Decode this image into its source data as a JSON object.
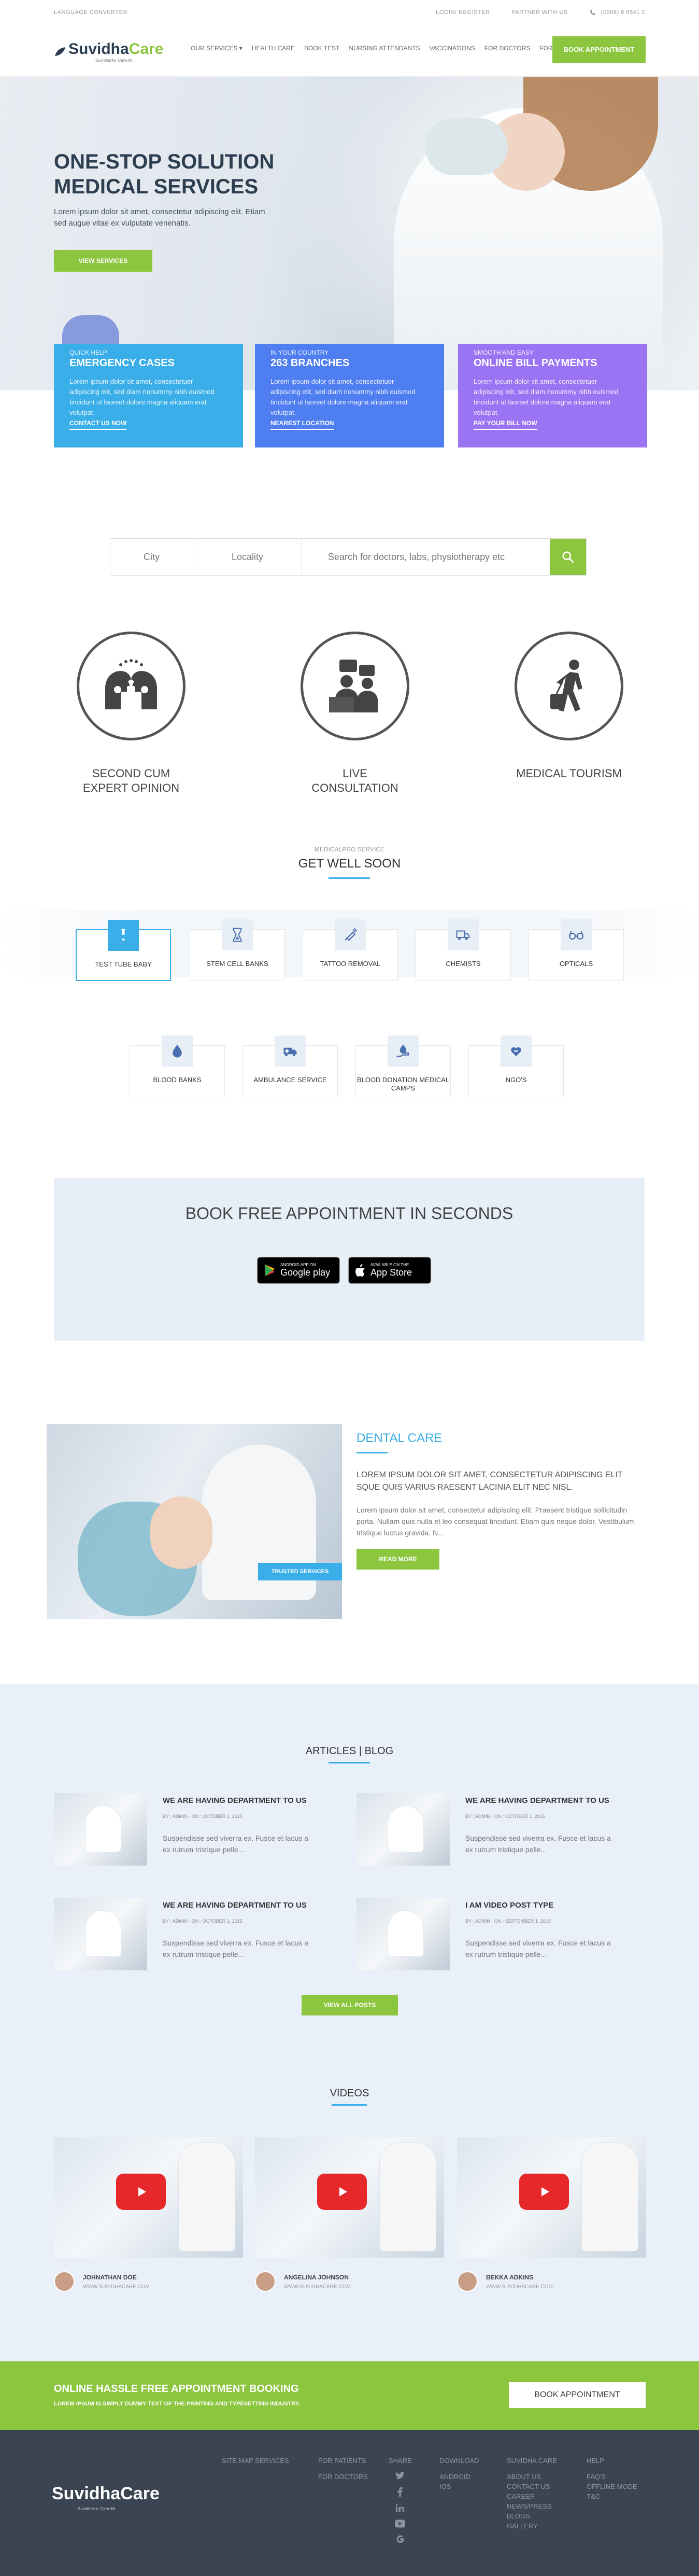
{
  "topbar": {
    "language": "LANGUAGE CONVERTER",
    "login": "LOGIN/ REGISTER",
    "partner": "PARTNER WITH US",
    "phone": "(0908) 8 6541 2"
  },
  "brand": {
    "name_a": "Suvidha",
    "name_b": "Care",
    "tagline": "SuvidhaHe. Care.Mr."
  },
  "nav": {
    "items": [
      "OUR SERVICES ▾",
      "HEALTH CARE",
      "BOOK TEST",
      "NURSING ATTENDANTS",
      "VACCINATIONS",
      "FOR DOCTORS",
      "FOR PATIENT"
    ],
    "book": "BOOK APPOINTMENT"
  },
  "hero": {
    "title": "ONE-STOP SOLUTION MEDICAL SERVICES",
    "text": "Lorem ipsum dolor sit amet, consectetur adipiscing elit. Etiam sed augue vitae ex vulputate venenatis.",
    "button": "VIEW SERVICES"
  },
  "cards": [
    {
      "kicker": "QUICK HELP",
      "title": "EMERGENCY CASES",
      "text": "Lorem ipsum dolor sit amet, consectetuer adipiscing elit, sed diam nonummy nibh euismod tincidunt ut laoreet dolore magna aliquam erat volutpat.",
      "link": "CONTACT US NOW",
      "color": "#3aaee8"
    },
    {
      "kicker": "IN YOUR COUNTRY",
      "title": "263 BRANCHES",
      "text": "Lorem ipsum dolor sit amet, consectetuer adipiscing elit, sed diam nonummy nibh euismod tincidunt ut laoreet dolore magna aliquam erat volutpat.",
      "link": "NEAREST LOCATION",
      "color": "#4f7ef0"
    },
    {
      "kicker": "SMOOTH AND EASY",
      "title": "ONLINE BILL PAYMENTS",
      "text": "Lorem ipsum dolor sit amet, consectetuer adipiscing elit, sed diam nonummy nibh euismod tincidunt ut laoreet dolore magna aliquam erat volutpat.",
      "link": "PAY YOUR BILL NOW",
      "color": "#9a74f2"
    }
  ],
  "search": {
    "city": "City",
    "locality": "Locality",
    "placeholder": "Search for doctors, labs, physiotherapy etc"
  },
  "services": [
    {
      "label": "SECOND CUM EXPERT OPINION",
      "icon": "heads-talking-icon"
    },
    {
      "label": "LIVE CONSULTATION",
      "icon": "doctor-chat-icon"
    },
    {
      "label": "MEDICAL TOURISM",
      "icon": "traveler-icon"
    }
  ],
  "getwell": {
    "kicker": "MEDICALPRO SERVICE",
    "title": "GET WELL SOON",
    "row1": [
      {
        "label": "TEST TUBE BABY",
        "icon": "test-tube-icon"
      },
      {
        "label": "STEM CELL BANKS",
        "icon": "hourglass-icon"
      },
      {
        "label": "TATTOO REMOVAL",
        "icon": "syringe-icon"
      },
      {
        "label": "CHEMISTS",
        "icon": "truck-icon"
      },
      {
        "label": "OPTICALS",
        "icon": "glasses-icon"
      }
    ],
    "row2": [
      {
        "label": "BLOOD BANKS",
        "icon": "blood-drop-icon"
      },
      {
        "label": "AMBULANCE SERVICE",
        "icon": "ambulance-icon"
      },
      {
        "label": "BLOOD DONATION MEDICAL CAMPS",
        "icon": "hand-drop-icon"
      },
      {
        "label": "NGO'S",
        "icon": "heart-hand-icon"
      }
    ]
  },
  "appointment": {
    "title": "BOOK FREE APPOINTMENT IN SECONDS",
    "google_small": "ANDROID APP ON",
    "google_big": "Google play",
    "apple_small": "Available on the",
    "apple_big": "App Store"
  },
  "dental": {
    "title": "DENTAL CARE",
    "badge": "TRUSTED SERVICES",
    "lead": "LOREM IPSUM DOLOR SIT AMET, CONSECTETUR ADIPISCING ELIT SQUE QUIS VARIUS RAESENT LACINIA ELIT NEC NISL.",
    "body": "Lorem ipsum dolor sit amet, consectetur adipiscing elit. Praesent tristique sollicitudin porta. Nullam quis nulla et leo consequat tincidunt. Etiam quis neque dolor. Vestibulum tristique luctus gravida. N...",
    "button": "READ MORE"
  },
  "blog": {
    "title": "ARTICLES | BLOG",
    "posts": [
      {
        "title": "WE ARE HAVING DEPARTMENT TO US",
        "meta": "BY : ADMIN · ON : OCTOBER 1, 2015",
        "excerpt": "Suspendisse sed viverra ex. Fusce et lacus a ex rutrum tristique pelle..."
      },
      {
        "title": "WE ARE HAVING DEPARTMENT TO US",
        "meta": "BY : ADMIN · ON : OCTOBER 1, 2015",
        "excerpt": "Suspendisse sed viverra ex. Fusce et lacus a ex rutrum tristique pelle..."
      },
      {
        "title": "WE ARE HAVING DEPARTMENT TO US",
        "meta": "BY : ADMIN · ON : OCTOBER 1, 2015",
        "excerpt": "Suspendisse sed viverra ex. Fusce et lacus a ex rutrum tristique pelle..."
      },
      {
        "title": "I AM VIDEO POST TYPE",
        "meta": "BY : ADMIN · ON : SEPTEMBER 1, 2015",
        "excerpt": "Suspendisse sed viverra ex. Fusce et lacus a ex rutrum tristique pelle..."
      }
    ],
    "view_all": "VIEW ALL POSTS"
  },
  "videos": {
    "title": "VIDEOS",
    "items": [
      {
        "name": "JOHNATHAN DOE",
        "site": "WWW.SUVIDHACARE.COM"
      },
      {
        "name": "ANGELINA JOHNSON",
        "site": "WWW.SUVIDHACARE.COM"
      },
      {
        "name": "BEKKA ADKINS",
        "site": "WWW.SUVIDHACARE.COM"
      }
    ]
  },
  "cta": {
    "title": "ONLINE HASSLE FREE APPOINTMENT BOOKING",
    "text": "LOREM IPSUM IS SIMPLY DUMMY TEXT OF THE PRINTING AND TYPESETTING INDUSTRY.",
    "button": "BOOK APPOINTMENT"
  },
  "footer": {
    "logo": "SuvidhaCare",
    "tag": "SuvidhaHe. Care.Mr.",
    "c1": [
      "SITE MAP SERVICES"
    ],
    "c2": [
      "FOR PATIENTS",
      "FOR DOCTORS"
    ],
    "share": "SHARE",
    "download": {
      "h": "DOWNLOAD",
      "items": [
        "ANDROID",
        "IOS"
      ]
    },
    "suvidha": {
      "h": "SUVIDHA CARE",
      "items": [
        "ABOUT US",
        "CONTACT US",
        "CAREER",
        "NEWS/PRESS",
        "BLOGS",
        "GALLERY"
      ]
    },
    "help": {
      "h": "HELP",
      "items": [
        "FAQ'S",
        "OFFLINE MODE",
        "T&C"
      ]
    }
  }
}
